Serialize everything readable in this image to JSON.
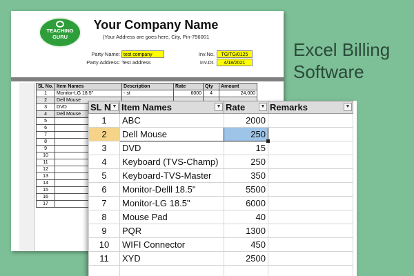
{
  "heading": {
    "line1": "Excel Billing",
    "line2": "Software"
  },
  "invoice": {
    "logo_text_1": "TEACHING",
    "logo_text_2": "GURU",
    "company_name": "Your Company Name",
    "address_line": "(Your Address are goes here, City, Pin-756001",
    "party_name_label": "Party Name:",
    "party_name_value": "test company",
    "party_address_label": "Party Address:",
    "party_address_value": "Test address",
    "inv_no_label": "Inv.No.",
    "inv_no_value": "TG/TG/0125",
    "inv_dt_label": "Inv.Dt.",
    "inv_dt_value": "4/18/2021",
    "columns": [
      "SL No.",
      "Item Names",
      "Description",
      "Rate",
      "Qty",
      "Amount"
    ],
    "rows": [
      {
        "sl": "1",
        "item": "Monitor-LG 18.5\"",
        "desc": "- st",
        "rate": "6000",
        "qty": "4",
        "amount": "24,000"
      },
      {
        "sl": "2",
        "item": "Dell Mouse",
        "desc": "",
        "rate": "",
        "qty": "",
        "amount": ""
      },
      {
        "sl": "3",
        "item": "DVD",
        "desc": "",
        "rate": "",
        "qty": "",
        "amount": ""
      },
      {
        "sl": "4",
        "item": "Dell Mouse",
        "desc": "",
        "rate": "",
        "qty": "",
        "amount": ""
      },
      {
        "sl": "5",
        "item": "",
        "desc": "",
        "rate": "",
        "qty": "",
        "amount": ""
      },
      {
        "sl": "6",
        "item": "",
        "desc": "",
        "rate": "",
        "qty": "",
        "amount": ""
      },
      {
        "sl": "7",
        "item": "",
        "desc": "",
        "rate": "",
        "qty": "",
        "amount": ""
      },
      {
        "sl": "8",
        "item": "",
        "desc": "",
        "rate": "",
        "qty": "",
        "amount": ""
      },
      {
        "sl": "9",
        "item": "",
        "desc": "",
        "rate": "",
        "qty": "",
        "amount": ""
      },
      {
        "sl": "10",
        "item": "",
        "desc": "",
        "rate": "",
        "qty": "",
        "amount": ""
      },
      {
        "sl": "11",
        "item": "",
        "desc": "",
        "rate": "",
        "qty": "",
        "amount": ""
      },
      {
        "sl": "12",
        "item": "",
        "desc": "",
        "rate": "",
        "qty": "",
        "amount": ""
      },
      {
        "sl": "13",
        "item": "",
        "desc": "",
        "rate": "",
        "qty": "",
        "amount": ""
      },
      {
        "sl": "14",
        "item": "",
        "desc": "",
        "rate": "",
        "qty": "",
        "amount": ""
      },
      {
        "sl": "15",
        "item": "",
        "desc": "",
        "rate": "",
        "qty": "",
        "amount": ""
      },
      {
        "sl": "16",
        "item": "",
        "desc": "",
        "rate": "",
        "qty": "",
        "amount": ""
      },
      {
        "sl": "17",
        "item": "",
        "desc": "",
        "rate": "",
        "qty": "",
        "amount": ""
      }
    ]
  },
  "item_master": {
    "columns": [
      "SL N",
      "Item Names",
      "Rate",
      "Remarks"
    ],
    "dropdown_icon": "dropdown-arrow-icon",
    "selected_row": 2,
    "rows": [
      {
        "sl": "1",
        "name": "ABC",
        "rate": "2000",
        "remarks": ""
      },
      {
        "sl": "2",
        "name": "Dell Mouse",
        "rate": "250",
        "remarks": ""
      },
      {
        "sl": "3",
        "name": "DVD",
        "rate": "15",
        "remarks": ""
      },
      {
        "sl": "4",
        "name": "Keyboard (TVS-Champ)",
        "rate": "250",
        "remarks": ""
      },
      {
        "sl": "5",
        "name": "Keyboard-TVS-Master",
        "rate": "350",
        "remarks": ""
      },
      {
        "sl": "6",
        "name": "Monitor-Delll 18.5\"",
        "rate": "5500",
        "remarks": ""
      },
      {
        "sl": "7",
        "name": "Monitor-LG 18.5\"",
        "rate": "6000",
        "remarks": ""
      },
      {
        "sl": "8",
        "name": "Mouse Pad",
        "rate": "40",
        "remarks": ""
      },
      {
        "sl": "9",
        "name": "PQR",
        "rate": "1300",
        "remarks": ""
      },
      {
        "sl": "10",
        "name": "WIFI Connector",
        "rate": "450",
        "remarks": ""
      },
      {
        "sl": "11",
        "name": "XYD",
        "rate": "2500",
        "remarks": ""
      }
    ]
  },
  "colors": {
    "background": "#7dbf96",
    "highlight_yellow": "#ffff00",
    "selected_cell": "#9ec5e8",
    "logo_green": "#2e9e3a"
  }
}
